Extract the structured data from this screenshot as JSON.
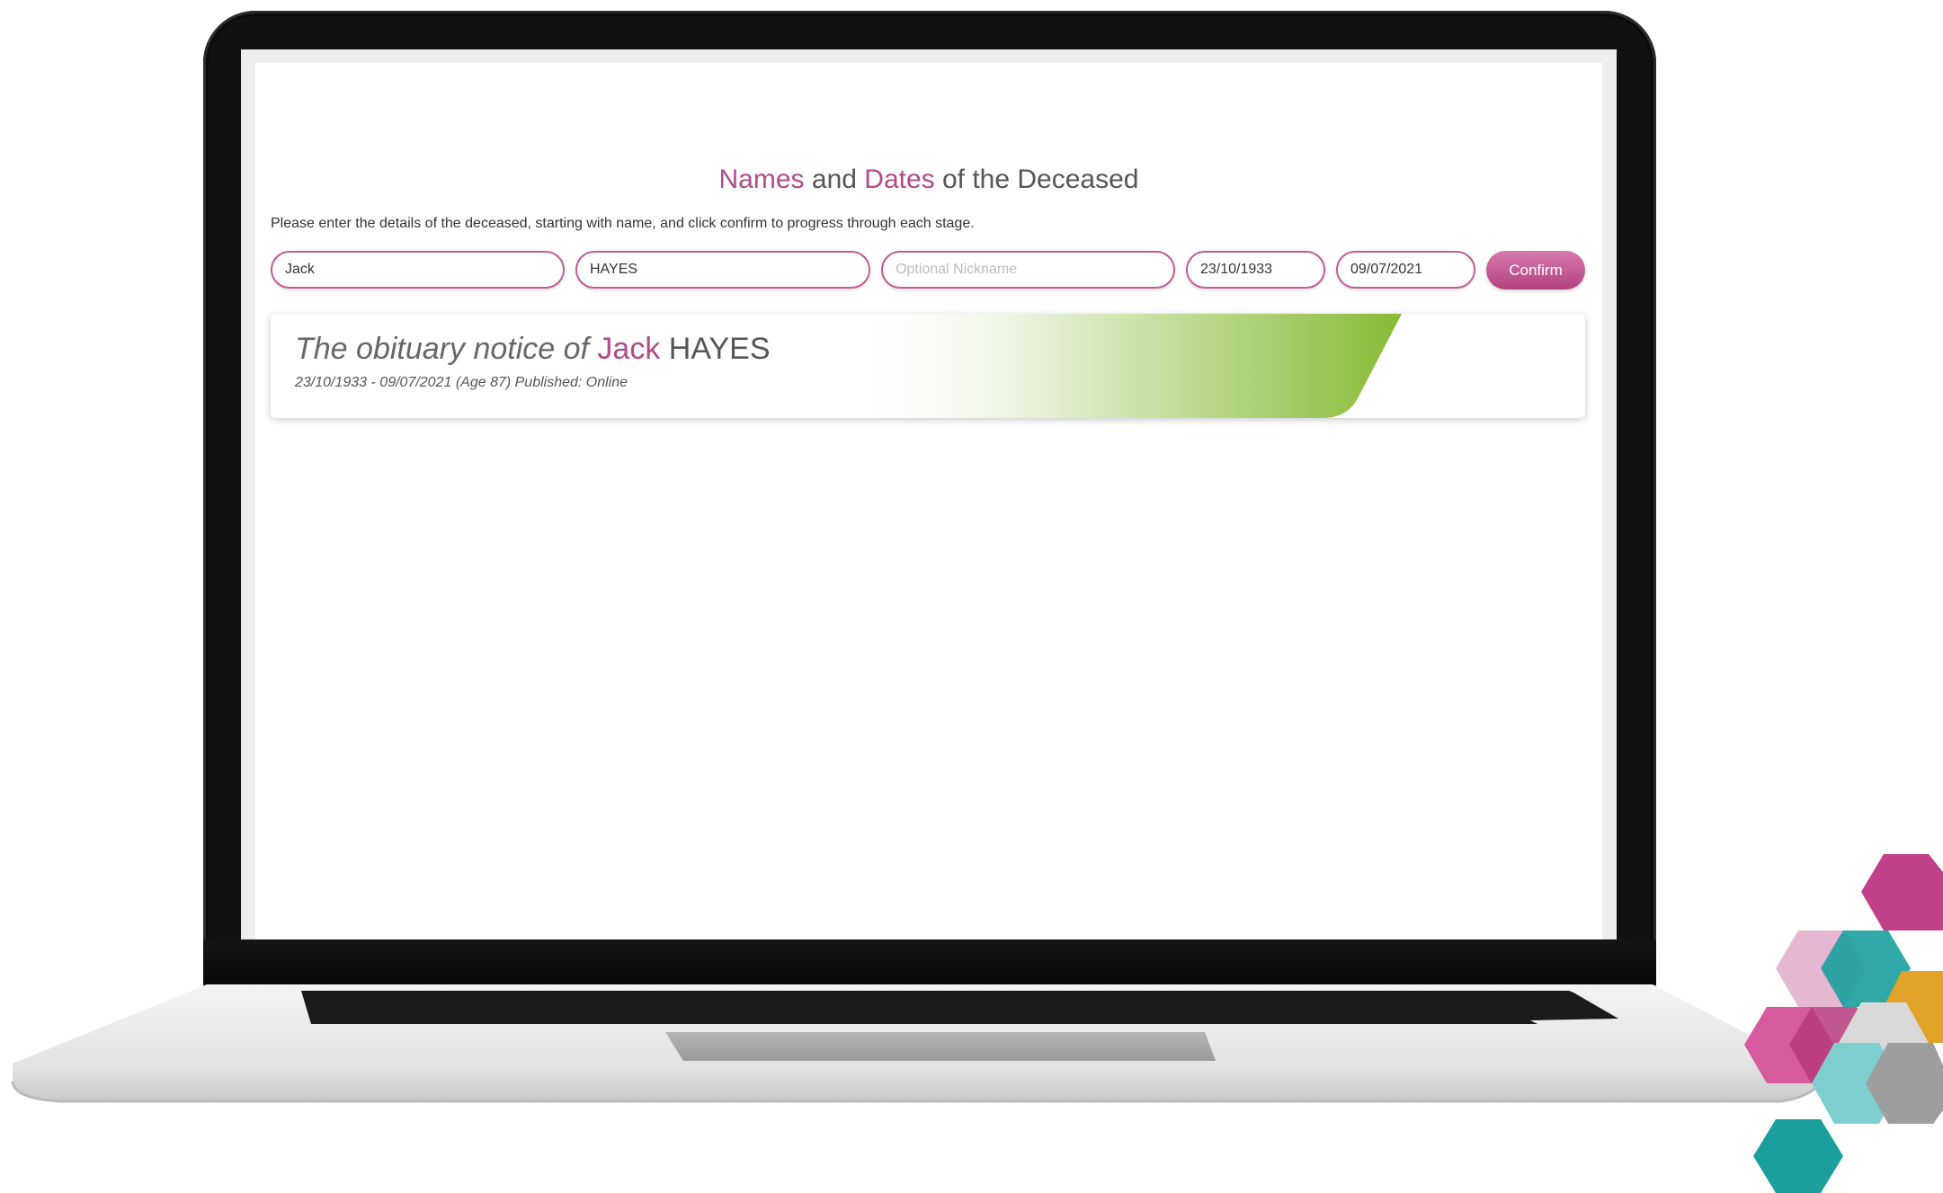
{
  "form": {
    "title_names": "Names",
    "title_and": " and ",
    "title_dates": "Dates",
    "title_rest": " of the Deceased",
    "instructions": "Please enter the details of the deceased, starting with name, and click confirm to progress through each stage.",
    "first_name_value": "Jack",
    "last_name_value": "HAYES",
    "nickname_placeholder": "Optional Nickname",
    "date_of_birth_value": "23/10/1933",
    "date_of_death_value": "09/07/2021",
    "confirm_label": "Confirm"
  },
  "notice": {
    "heading_prefix": "The obituary notice of ",
    "first_name": "Jack",
    "last_name": " HAYES",
    "subheading": "23/10/1933 - 09/07/2021 (Age 87) Published: Online"
  },
  "colors": {
    "accent": "#b04a8a",
    "banner_green": "#8dbf3c",
    "hex_magenta": "#c0408a",
    "hex_teal": "#1a9f9d",
    "hex_orange": "#e0a227"
  }
}
